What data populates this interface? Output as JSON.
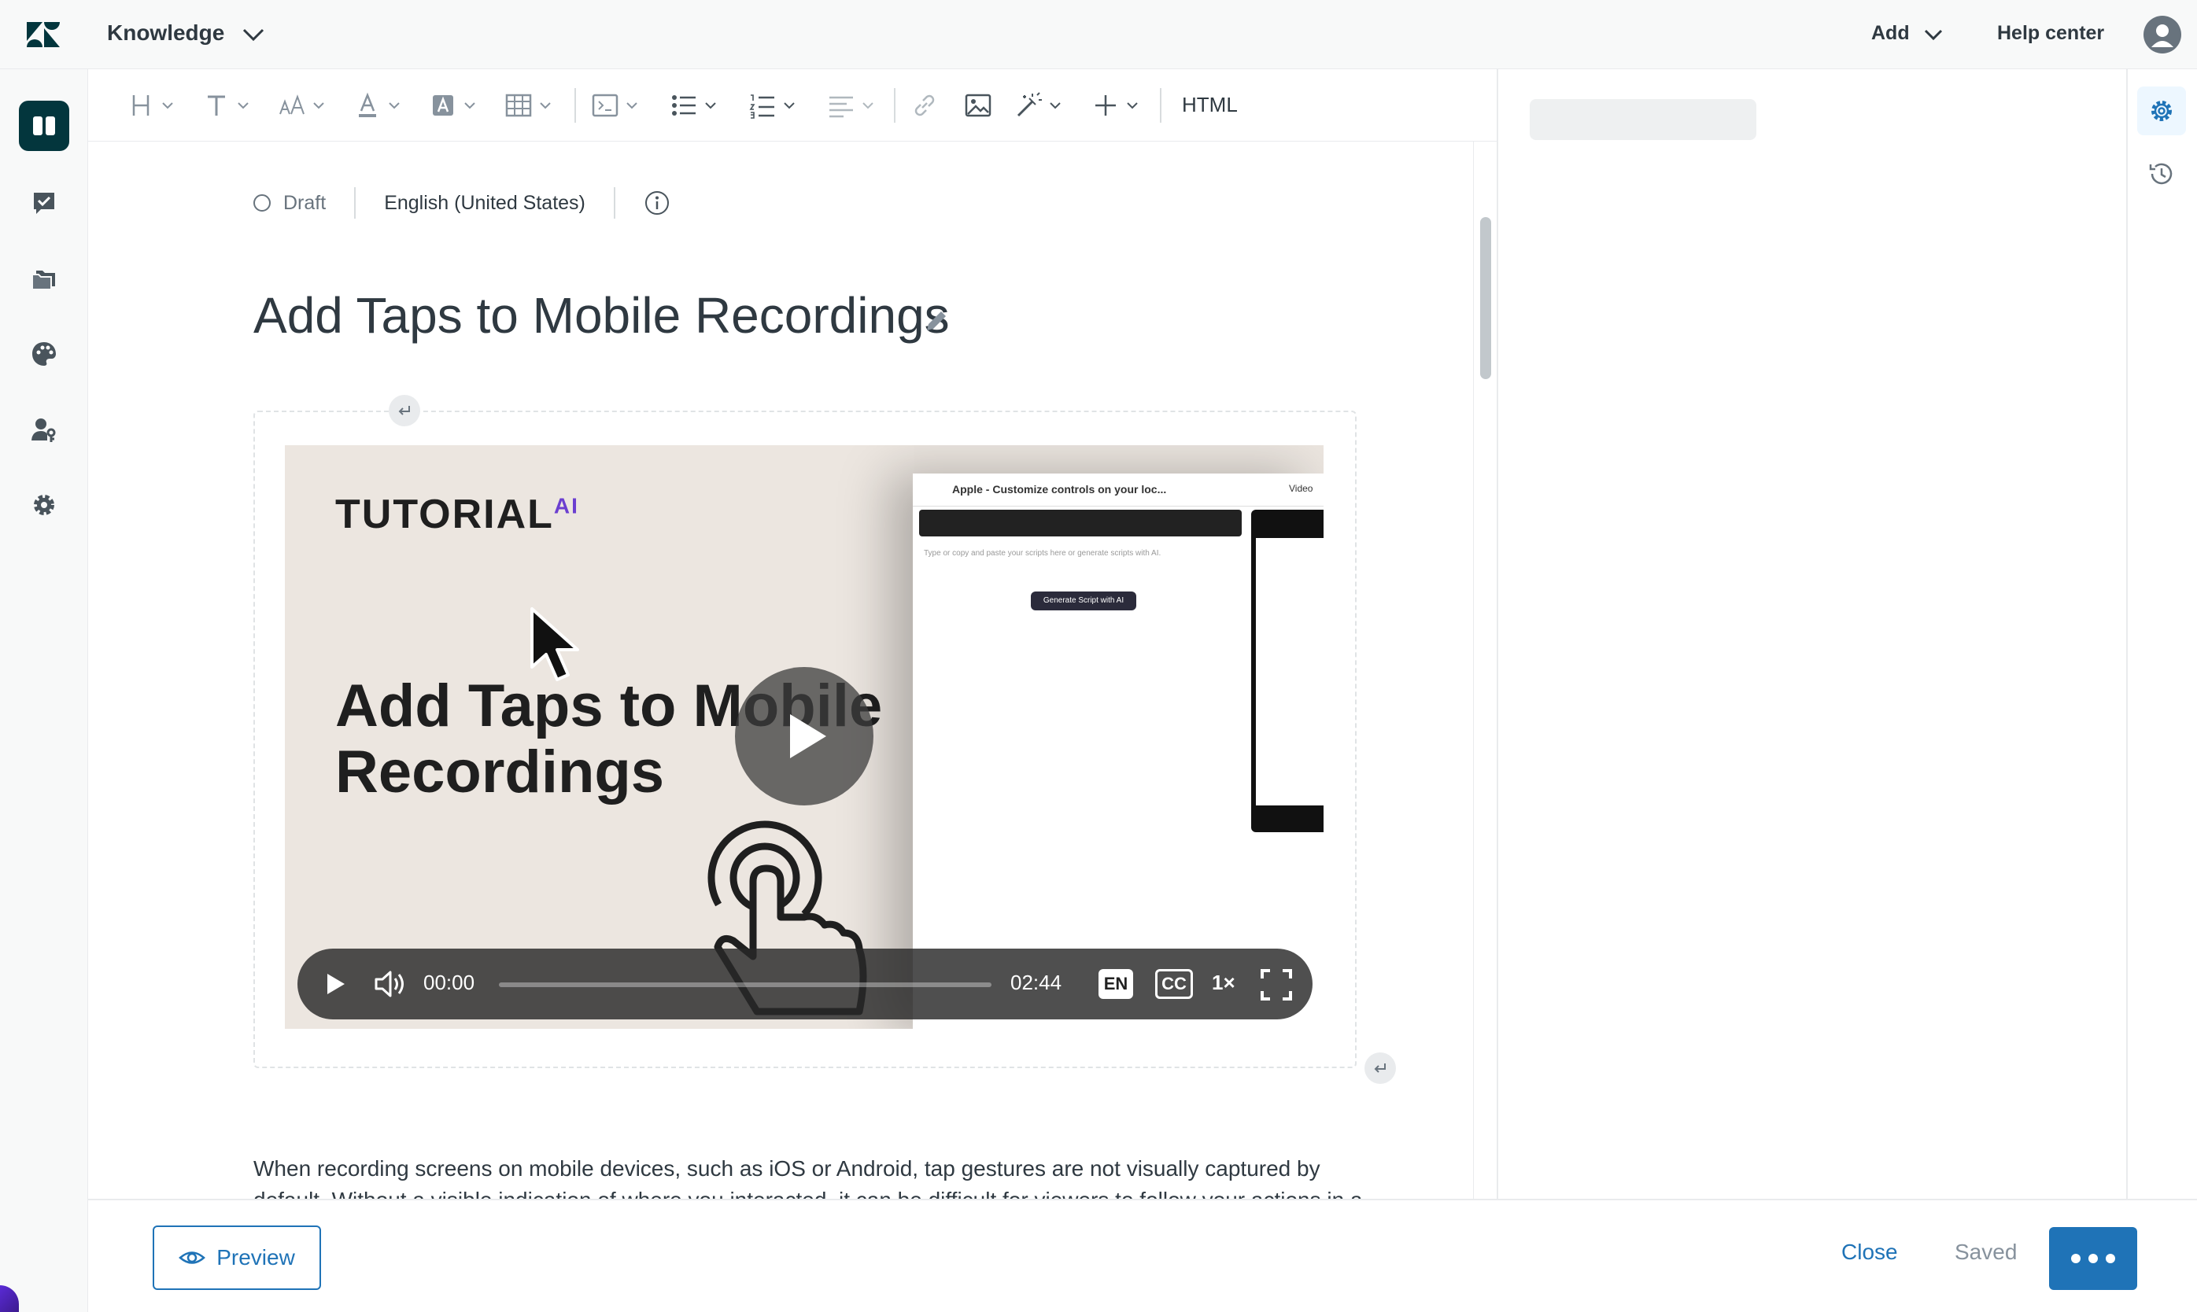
{
  "topbar": {
    "product": "Knowledge",
    "add_label": "Add",
    "help_center_label": "Help center"
  },
  "leftnav": {
    "items": [
      {
        "icon": "knowledge-book-icon",
        "active": true
      },
      {
        "icon": "check-bubble-icon",
        "active": false
      },
      {
        "icon": "folders-icon",
        "active": false
      },
      {
        "icon": "palette-icon",
        "active": false
      },
      {
        "icon": "user-permissions-icon",
        "active": false
      },
      {
        "icon": "settings-gear-icon",
        "active": false
      }
    ]
  },
  "toolbar": {
    "html_label": "HTML"
  },
  "article": {
    "status": "Draft",
    "language": "English (United States)",
    "title": "Add Taps to Mobile Recordings",
    "body": "When recording screens on mobile devices, such as iOS or Android, tap gestures are not visually captured by default. Without a visible indication of where you interacted, it can be difficult for viewers to follow your actions in a tutorial or demo video. This article explains how to visually highlight taps using Tutorial AI’s Tap Marker tools, so your viewers can follow along with clarity."
  },
  "video": {
    "logo_text": "TUTORIAL",
    "logo_suffix": "AI",
    "headline": "Add Taps to Mobile Recordings",
    "inner_window_title": "Apple - Customize controls on your loc...",
    "inner_tab": "Video",
    "inner_hint": "Type or copy and paste your scripts here or generate scripts with AI.",
    "inner_button": "Generate Script with AI",
    "current_time": "00:00",
    "duration": "02:44",
    "progress": 0,
    "lang_badge": "EN",
    "cc_badge": "CC",
    "speed": "1×"
  },
  "footer": {
    "preview_label": "Preview",
    "close_label": "Close",
    "saved_label": "Saved"
  },
  "colors": {
    "accent": "#1f73b7",
    "nav_active": "#03363d",
    "text": "#2f3941",
    "muted": "#87929d"
  }
}
